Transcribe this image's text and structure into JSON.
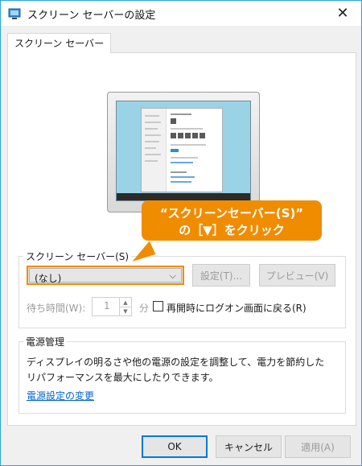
{
  "window": {
    "title": "スクリーン セーバーの設定",
    "close_glyph": "✕"
  },
  "tab": {
    "label": "スクリーン セーバー"
  },
  "callout": {
    "line1": "“スクリーンセーバー(S)”",
    "line2": "の［▼］をクリック",
    "color": "#f08c00"
  },
  "screensaver_group": {
    "legend": "スクリーン セーバー(S)",
    "dropdown_value": "(なし)",
    "settings_button": "設定(T)...",
    "preview_button": "プレビュー(V)",
    "wait_label": "待ち時間(W):",
    "wait_value": "1",
    "wait_unit": "分",
    "resume_checkbox_label": "再開時にログオン画面に戻る(R)",
    "resume_checked": false
  },
  "power_group": {
    "legend": "電源管理",
    "description": "ディスプレイの明るさや他の電源の設定を調整して、電力を節約したリパフォーマンスを最大にしたりできます。",
    "link": "電源設定の変更"
  },
  "footer": {
    "ok": "OK",
    "cancel": "キャンセル",
    "apply": "適用(A)"
  },
  "colors": {
    "accent": "#f08c00",
    "link": "#0066cc",
    "ok_border": "#0078d7",
    "window_border": "#2aa6d6"
  }
}
